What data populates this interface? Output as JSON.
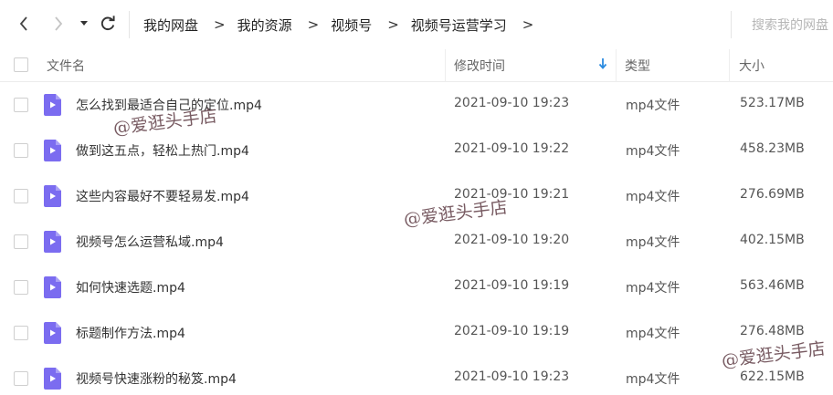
{
  "nav": {
    "back_icon": "chevron-left-icon",
    "forward_icon": "chevron-right-icon",
    "dropdown_icon": "caret-down-icon",
    "refresh_icon": "refresh-icon"
  },
  "breadcrumb": {
    "items": [
      "我的网盘",
      "我的资源",
      "视频号",
      "视频号运营学习"
    ],
    "separator": ">"
  },
  "search": {
    "placeholder": "搜索我的网盘"
  },
  "table": {
    "headers": {
      "name": "文件名",
      "modified": "修改时间",
      "type": "类型",
      "size": "大小"
    },
    "sort_icon": "arrow-down-icon",
    "accent_color": "#2a8be0",
    "file_icon_color": "#7b6cf0",
    "rows": [
      {
        "name": "怎么找到最适合自己的定位.mp4",
        "modified": "2021-09-10 19:23",
        "type": "mp4文件",
        "size": "523.17MB"
      },
      {
        "name": "做到这五点，轻松上热门.mp4",
        "modified": "2021-09-10 19:22",
        "type": "mp4文件",
        "size": "458.23MB"
      },
      {
        "name": "这些内容最好不要轻易发.mp4",
        "modified": "2021-09-10 19:21",
        "type": "mp4文件",
        "size": "276.69MB"
      },
      {
        "name": "视频号怎么运营私域.mp4",
        "modified": "2021-09-10 19:20",
        "type": "mp4文件",
        "size": "402.15MB"
      },
      {
        "name": "如何快速选题.mp4",
        "modified": "2021-09-10 19:19",
        "type": "mp4文件",
        "size": "563.46MB"
      },
      {
        "name": "标题制作方法.mp4",
        "modified": "2021-09-10 19:19",
        "type": "mp4文件",
        "size": "276.48MB"
      },
      {
        "name": "视频号快速涨粉的秘笈.mp4",
        "modified": "2021-09-10 19:23",
        "type": "mp4文件",
        "size": "622.15MB"
      }
    ]
  },
  "watermarks": [
    "@爱逛头手店",
    "@爱逛头手店",
    "@爱逛头手店"
  ]
}
